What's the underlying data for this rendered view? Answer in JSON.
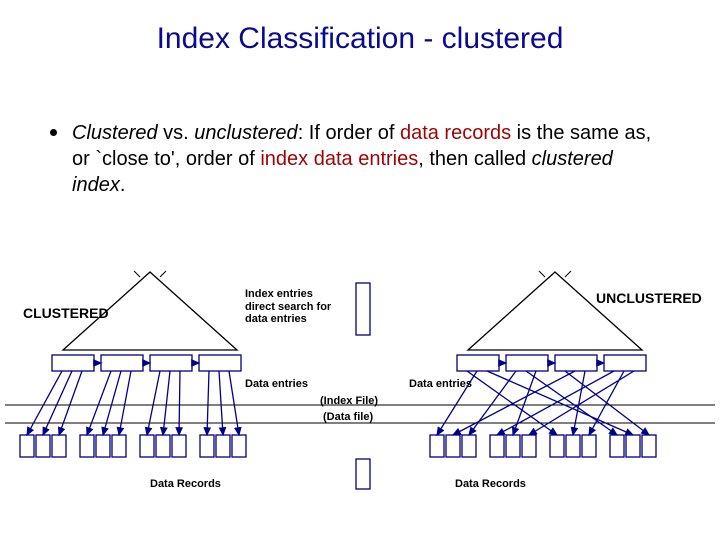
{
  "title": "Index Classification - clustered",
  "bullet": {
    "leadItalic1": "Clustered",
    "vs": " vs. ",
    "leadItalic2": "unclustered",
    "afterColon": ":  If order of ",
    "maroon1": "data records",
    "mid1": " is the same as, or `close to', order of ",
    "maroon2": "index data entries",
    "mid2": ", then called ",
    "italicEnd": "clustered index",
    "period": "."
  },
  "labels": {
    "clustered": "CLUSTERED",
    "unclustered": "UNCLUSTERED",
    "indexEntries": "Index entries\ndirect search for\ndata entries",
    "dataEntries": "Data entries",
    "indexFile": "(Index File)",
    "dataFile": "(Data file)",
    "dataRecords": "Data Records"
  },
  "chart_data": {
    "type": "diagram",
    "concept": "Clustered vs Unclustered Index",
    "left": {
      "name": "CLUSTERED",
      "tree_leaves": 4,
      "data_record_groups": 4,
      "mapping": "sequential (leaf i → group i)"
    },
    "right": {
      "name": "UNCLUSTERED",
      "tree_leaves": 4,
      "data_record_groups": 4,
      "mapping": "scattered / cross-linked"
    },
    "layers": [
      "Index entries",
      "Data entries (Index File)",
      "Data Records (Data file)"
    ]
  }
}
